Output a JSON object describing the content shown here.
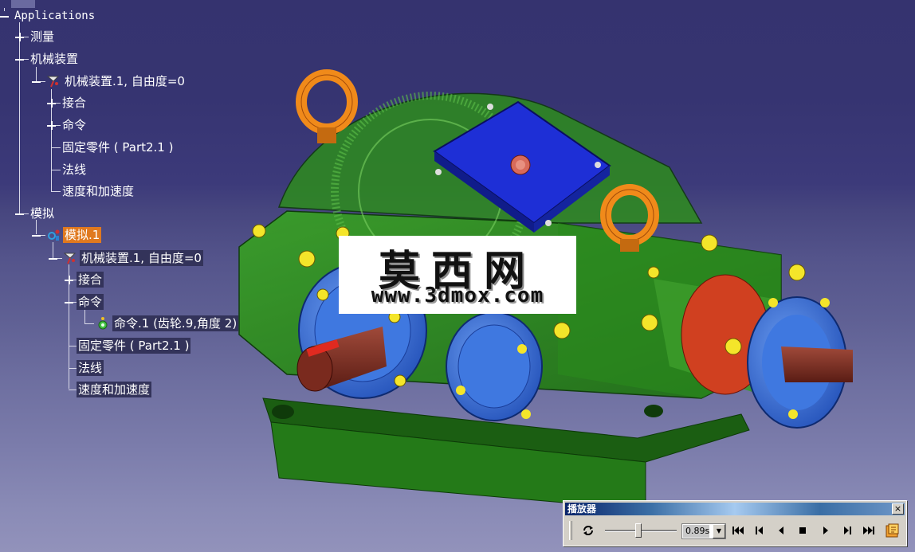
{
  "tree": {
    "root_label": "Applications",
    "nodes": {
      "measure": "测量",
      "mechanisms": "机械装置",
      "mech_assembly": "机械装置.1, 自由度=0",
      "joints": "接合",
      "commands": "命令",
      "fixed_part": "固定零件 ( Part2.1 )",
      "laws": "法线",
      "speed_accel": "速度和加速度",
      "simulation": "模拟",
      "sim1": "模拟.1",
      "sim_mech": "机械装置.1, 自由度=0",
      "sim_joints": "接合",
      "sim_commands": "命令",
      "sim_cmd1": "命令.1 (齿轮.9,角度 2)",
      "sim_fixed": "固定零件 ( Part2.1 )",
      "sim_laws": "法线",
      "sim_speed": "速度和加速度"
    }
  },
  "watermark": {
    "big": "莫西网",
    "small": "www.3dmox.com"
  },
  "player": {
    "title": "播放器",
    "close": "×",
    "time_value": "0.89s",
    "slider_position": 0.45
  },
  "colors": {
    "highlight": "#e0791f",
    "gearbox_green": "#2e8b1e",
    "flange_blue": "#3a6fd8",
    "top_plate": "#1e2fd6",
    "bolt_yellow": "#f4e52a",
    "ring_orange": "#f08a1a",
    "shaft_red": "#7a2a1e"
  },
  "icons": [
    "expand-icon",
    "collapse-icon",
    "mechanism-icon",
    "simulation-icon",
    "command-icon",
    "loop-icon",
    "first-icon",
    "step-back-icon",
    "play-back-icon",
    "stop-icon",
    "play-icon",
    "step-forward-icon",
    "last-icon",
    "options-icon"
  ]
}
